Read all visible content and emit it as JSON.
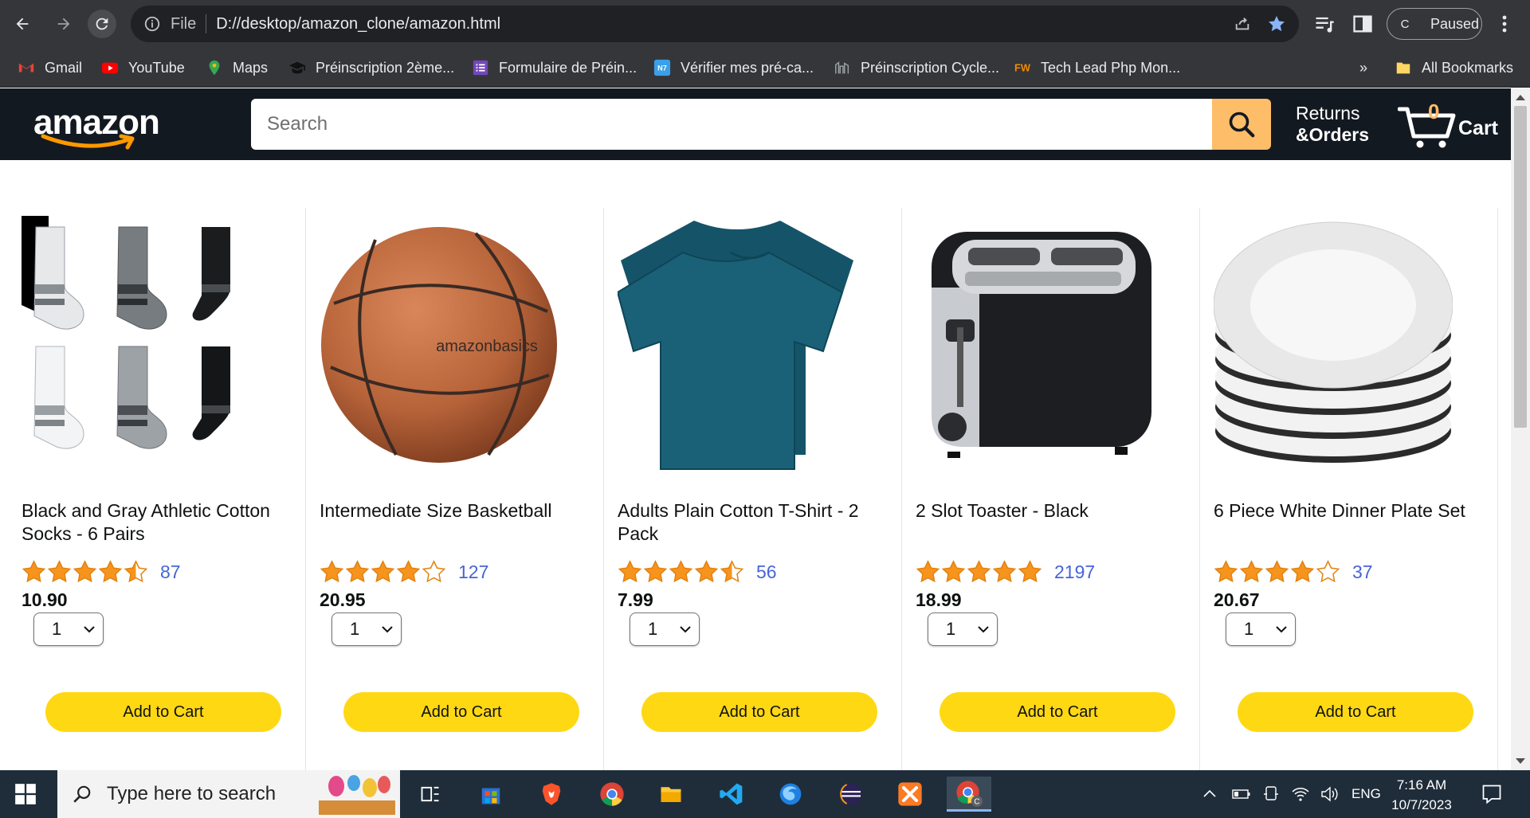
{
  "browser": {
    "omnibox": {
      "file_label": "File",
      "url": "D://desktop/amazon_clone/amazon.html"
    },
    "profile": {
      "initial": "C",
      "status": "Paused"
    },
    "bookmarks": [
      {
        "label": "Gmail",
        "icon": "gmail-icon",
        "color": "#ea4335"
      },
      {
        "label": "YouTube",
        "icon": "youtube-icon",
        "color": "#ff0000"
      },
      {
        "label": "Maps",
        "icon": "maps-icon",
        "color": "#34a853"
      },
      {
        "label": "Préinscription 2ème...",
        "icon": "graduation-cap-icon",
        "color": "#111111"
      },
      {
        "label": "Formulaire de Préin...",
        "icon": "form-icon",
        "color": "#7248b9"
      },
      {
        "label": "Vérifier mes pré-ca...",
        "icon": "site-icon",
        "color": "#1a73e8"
      },
      {
        "label": "Préinscription Cycle...",
        "icon": "building-icon",
        "color": "#9aa0a6"
      },
      {
        "label": "Tech Lead Php Mon...",
        "icon": "fw-icon",
        "color": "#f28b00"
      }
    ],
    "all_bookmarks_label": "All Bookmarks",
    "more_label": "»"
  },
  "header": {
    "logo_text": "amazon",
    "search": {
      "placeholder": "Search",
      "value": ""
    },
    "returns": {
      "line1": "Returns",
      "line2": "&Orders"
    },
    "cart": {
      "count": "0",
      "label": "Cart"
    }
  },
  "products": [
    {
      "name": "Black and Gray Athletic Cotton Socks - 6 Pairs",
      "rating": 4.5,
      "rating_count": "87",
      "price": "10.90",
      "quantity": "1",
      "add_label": "Add to Cart",
      "image": "socks"
    },
    {
      "name": "Intermediate Size Basketball",
      "rating": 4.0,
      "rating_count": "127",
      "price": "20.95",
      "quantity": "1",
      "add_label": "Add to Cart",
      "image": "basketball"
    },
    {
      "name": "Adults Plain Cotton T-Shirt - 2 Pack",
      "rating": 4.5,
      "rating_count": "56",
      "price": "7.99",
      "quantity": "1",
      "add_label": "Add to Cart",
      "image": "tshirt"
    },
    {
      "name": "2 Slot Toaster - Black",
      "rating": 5.0,
      "rating_count": "2197",
      "price": "18.99",
      "quantity": "1",
      "add_label": "Add to Cart",
      "image": "toaster"
    },
    {
      "name": "6 Piece White Dinner Plate Set",
      "rating": 4.0,
      "rating_count": "37",
      "price": "20.67",
      "quantity": "1",
      "add_label": "Add to Cart",
      "image": "plates"
    }
  ],
  "taskbar": {
    "search_placeholder": "Type here to search",
    "language": "ENG",
    "time": "7:16 AM",
    "date": "10/7/2023"
  },
  "colors": {
    "amazon_header": "#131921",
    "search_button": "#febd69",
    "add_to_cart": "#ffd814",
    "star": "#f7941d",
    "rating_count": "#4664d8"
  }
}
